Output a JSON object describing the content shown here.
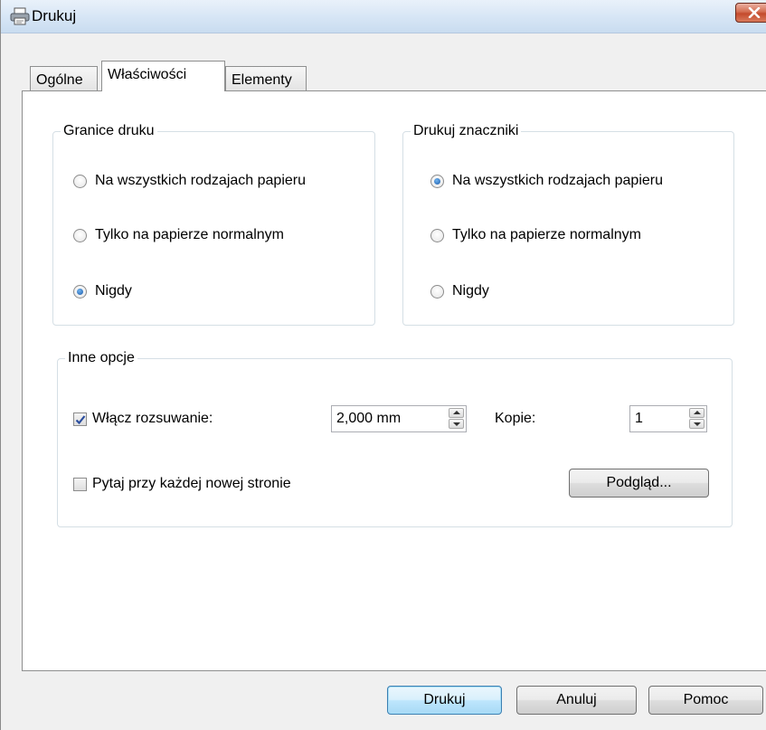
{
  "window": {
    "title": "Drukuj"
  },
  "tabs": [
    {
      "label": "Ogólne"
    },
    {
      "label": "Właściwości"
    },
    {
      "label": "Elementy"
    }
  ],
  "print_bounds": {
    "title": "Granice druku",
    "options": [
      "Na wszystkich rodzajach papieru",
      "Tylko na papierze normalnym",
      "Nigdy"
    ],
    "selected": "Nigdy"
  },
  "print_marks": {
    "title": "Drukuj znaczniki",
    "options": [
      "Na wszystkich rodzajach papieru",
      "Tylko na papierze normalnym",
      "Nigdy"
    ],
    "selected": "Na wszystkich rodzajach papieru"
  },
  "other_options": {
    "title": "Inne opcje",
    "spread_label": "Włącz rozsuwanie:",
    "spread_checked": true,
    "spread_value": "2,000 mm",
    "copies_label": "Kopie:",
    "copies_value": "1",
    "ask_label": "Pytaj przy każdej nowej stronie",
    "ask_checked": false,
    "preview_button": "Podgląd..."
  },
  "footer": {
    "print_button": "Drukuj",
    "cancel_button": "Anuluj",
    "help_button": "Pomoc"
  },
  "icons": [
    "printer-icon",
    "close-icon",
    "checkmark-icon"
  ]
}
